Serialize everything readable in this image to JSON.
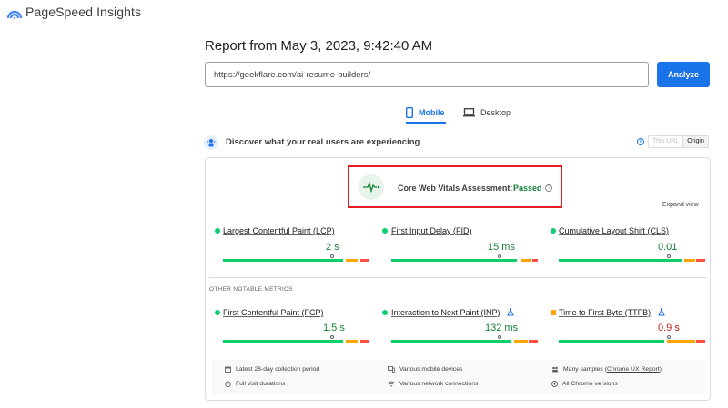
{
  "app": {
    "title": "PageSpeed Insights"
  },
  "report": {
    "title": "Report from May 3, 2023, 9:42:40 AM"
  },
  "url_input": {
    "value": "https://geekflare.com/ai-resume-builders/"
  },
  "analyze_button": {
    "label": "Analyze"
  },
  "tabs": [
    {
      "label": "Mobile",
      "active": true
    },
    {
      "label": "Desktop",
      "active": false
    }
  ],
  "discover": {
    "text": "Discover what your real users are experiencing"
  },
  "scope_toggle": {
    "this_url": "This URL",
    "origin": "Origin"
  },
  "cwv": {
    "label": "Core Web Vitals Assessment:",
    "status": "Passed"
  },
  "expand_view": "Expand view",
  "other_metrics_label": "OTHER NOTABLE METRICS",
  "colors": {
    "good": "#0cce6b",
    "good_text": "#188038",
    "average": "#ffa400",
    "average_text": "#c5221f",
    "poor": "#ff4e42",
    "accent": "#1a73e8"
  },
  "core_metrics": [
    {
      "name": "Largest Contentful Paint (LCP)",
      "value": "2 s",
      "status": "good",
      "marker": 0.68
    },
    {
      "name": "First Input Delay (FID)",
      "value": "15 ms",
      "status": "good",
      "marker": 0.68
    },
    {
      "name": "Cumulative Layout Shift (CLS)",
      "value": "0.01",
      "status": "good",
      "marker": 0.68
    }
  ],
  "other_metrics": [
    {
      "name": "First Contentful Paint (FCP)",
      "value": "1.5 s",
      "status": "good",
      "marker": 0.68
    },
    {
      "name": "Interaction to Next Paint (INP)",
      "value": "132 ms",
      "status": "good",
      "marker": 0.68,
      "experimental": true
    },
    {
      "name": "Time to First Byte (TTFB)",
      "value": "0.9 s",
      "status": "average",
      "marker": 0.68,
      "experimental": true
    }
  ],
  "footer": {
    "collection_period": "Latest 28-day collection period",
    "visit_durations": "Full visit durations",
    "devices": "Various mobile devices",
    "network": "Various network connections",
    "samples_prefix": "Many samples (",
    "samples_link": "Chrome UX Report",
    "samples_suffix": ")",
    "chrome_versions": "All Chrome versions"
  }
}
